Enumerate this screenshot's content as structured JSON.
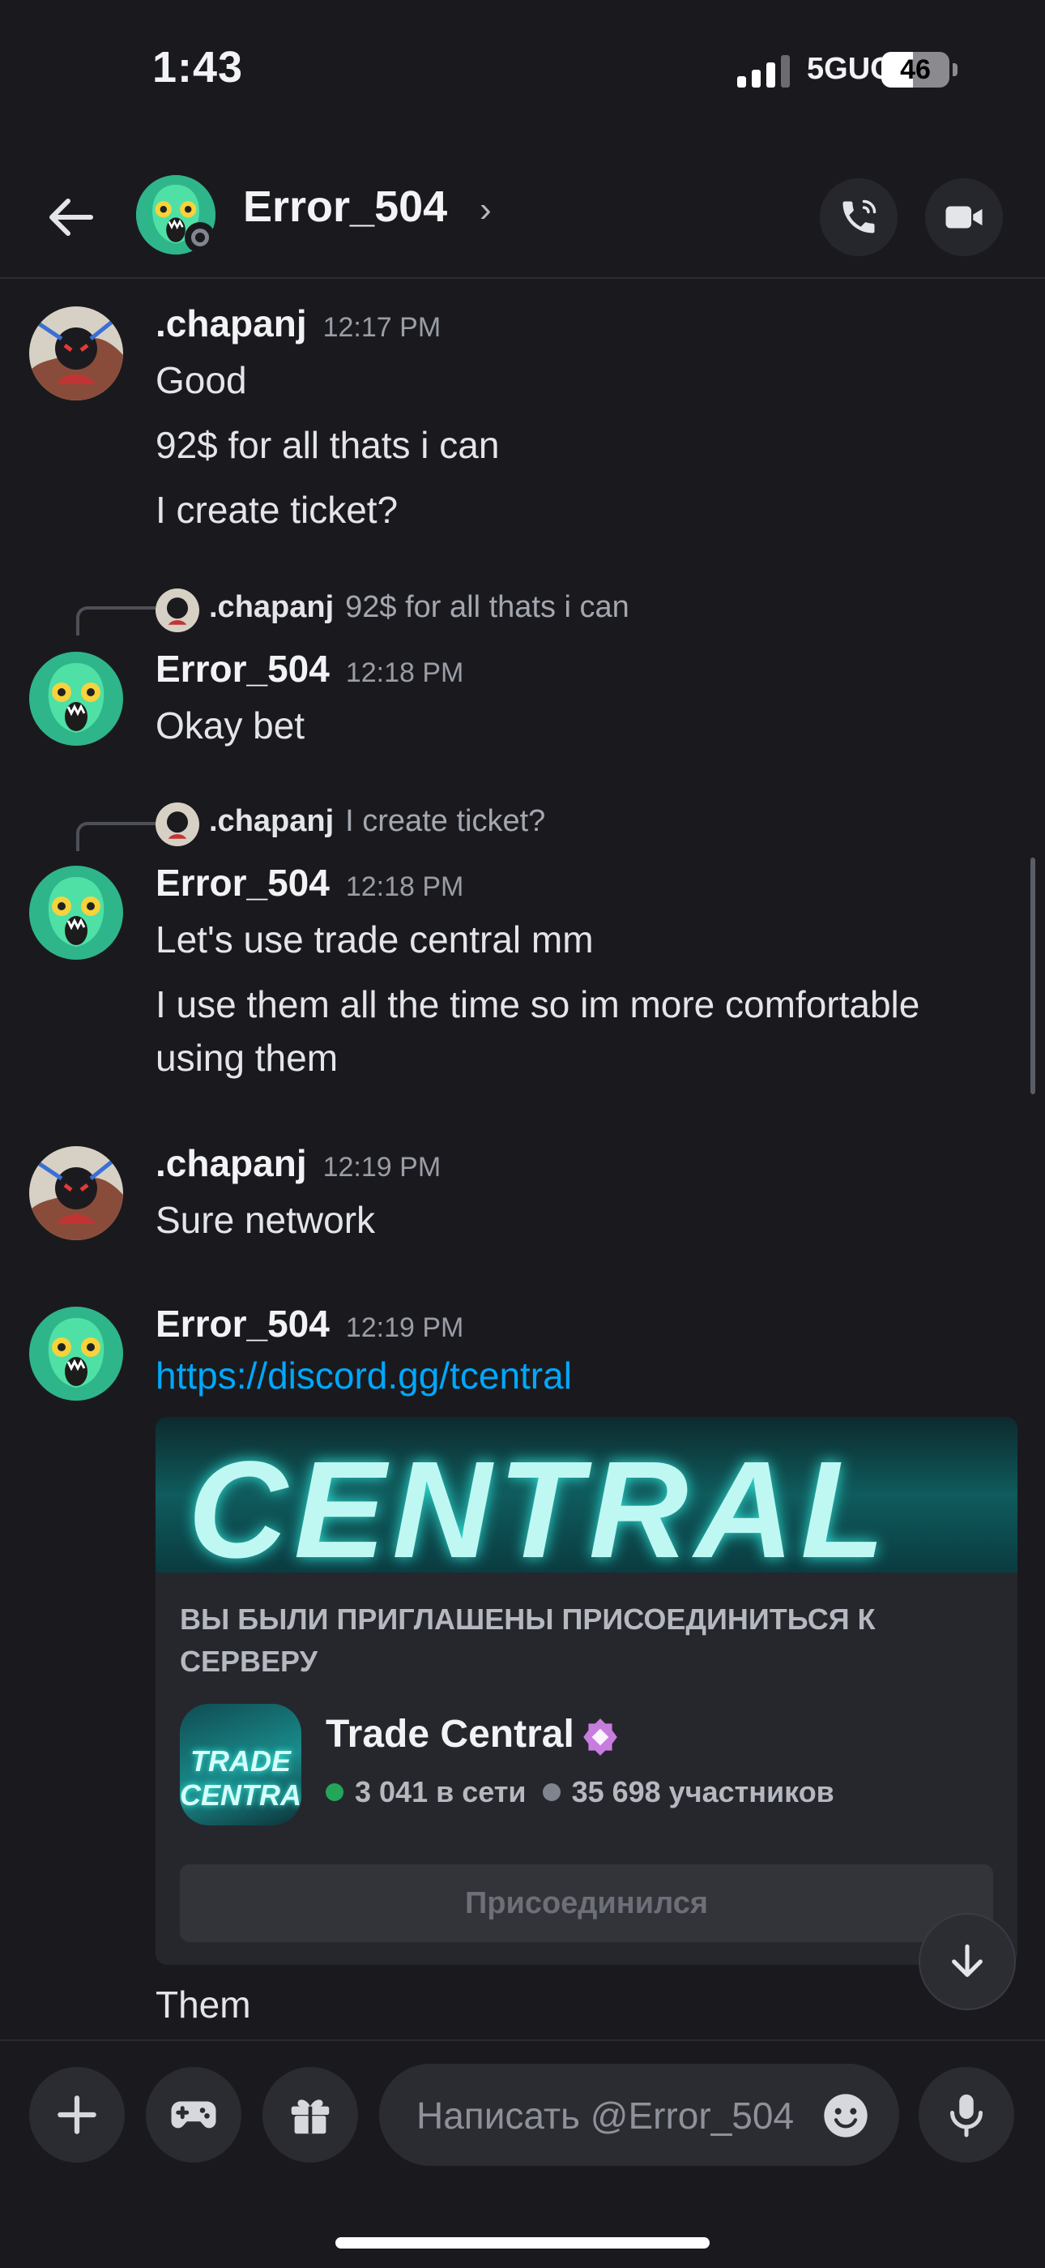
{
  "status_bar": {
    "time": "1:43",
    "network": "5GUC",
    "battery": "46",
    "battery_fraction": 0.46
  },
  "header": {
    "title": "Error_504",
    "chevron": "›"
  },
  "messages": [
    {
      "author": ".chapanj",
      "time": "12:17 PM",
      "lines": [
        "Good",
        "92$ for all thats i can",
        "I create ticket?"
      ]
    },
    {
      "reply_to": {
        "author": ".chapanj",
        "text": "92$ for all thats i can"
      },
      "author": "Error_504",
      "time": "12:18 PM",
      "lines": [
        "Okay bet"
      ]
    },
    {
      "reply_to": {
        "author": ".chapanj",
        "text": "I create ticket?"
      },
      "author": "Error_504",
      "time": "12:18 PM",
      "lines": [
        "Let's use trade central mm",
        "I use them all the time so im more comfortable using them"
      ]
    },
    {
      "author": ".chapanj",
      "time": "12:19 PM",
      "lines": [
        "Sure network"
      ]
    },
    {
      "author": "Error_504",
      "time": "12:19 PM",
      "link": "https://discord.gg/tcentral",
      "after": "Them"
    }
  ],
  "invite": {
    "banner_text": "CENTRAL",
    "heading": "ВЫ БЫЛИ ПРИГЛАШЕНЫ ПРИСОЕДИНИТЬСЯ К СЕРВЕРУ",
    "icon_text": "TRADE CENTRAL",
    "server_name": "Trade Central",
    "online": "3 041 в сети",
    "members": "35 698 участников",
    "button": "Присоединился",
    "online_color": "#23a55a",
    "members_color": "#80848e"
  },
  "composer": {
    "placeholder": "Написать @Error_504"
  },
  "colors": {
    "background": "#1a1a1e",
    "link": "#00a8fc",
    "accent_teal": "#2fb58a"
  }
}
